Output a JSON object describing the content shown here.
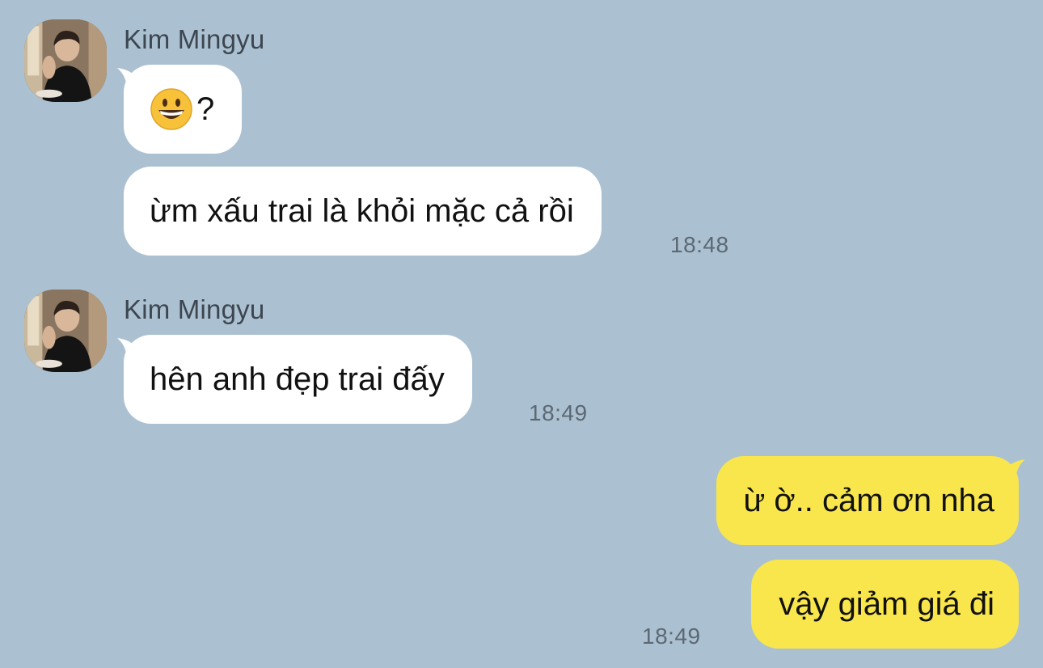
{
  "messages": [
    {
      "sender": "Kim Mingyu",
      "text": "?",
      "emoji": "grinning-face-emoji"
    },
    {
      "sender": "Kim Mingyu",
      "text": "ừm xấu trai là khỏi mặc cả rồi",
      "time": "18:48"
    },
    {
      "sender": "Kim Mingyu",
      "text": "hên anh đẹp trai đấy",
      "time": "18:49"
    },
    {
      "sender": "me",
      "text": "ừ ờ.. cảm ơn nha"
    },
    {
      "sender": "me",
      "text": "vậy giảm giá đi",
      "time": "18:49"
    }
  ],
  "colors": {
    "background": "#abc1d1",
    "incoming_bubble": "#ffffff",
    "outgoing_bubble": "#f9e64c"
  }
}
